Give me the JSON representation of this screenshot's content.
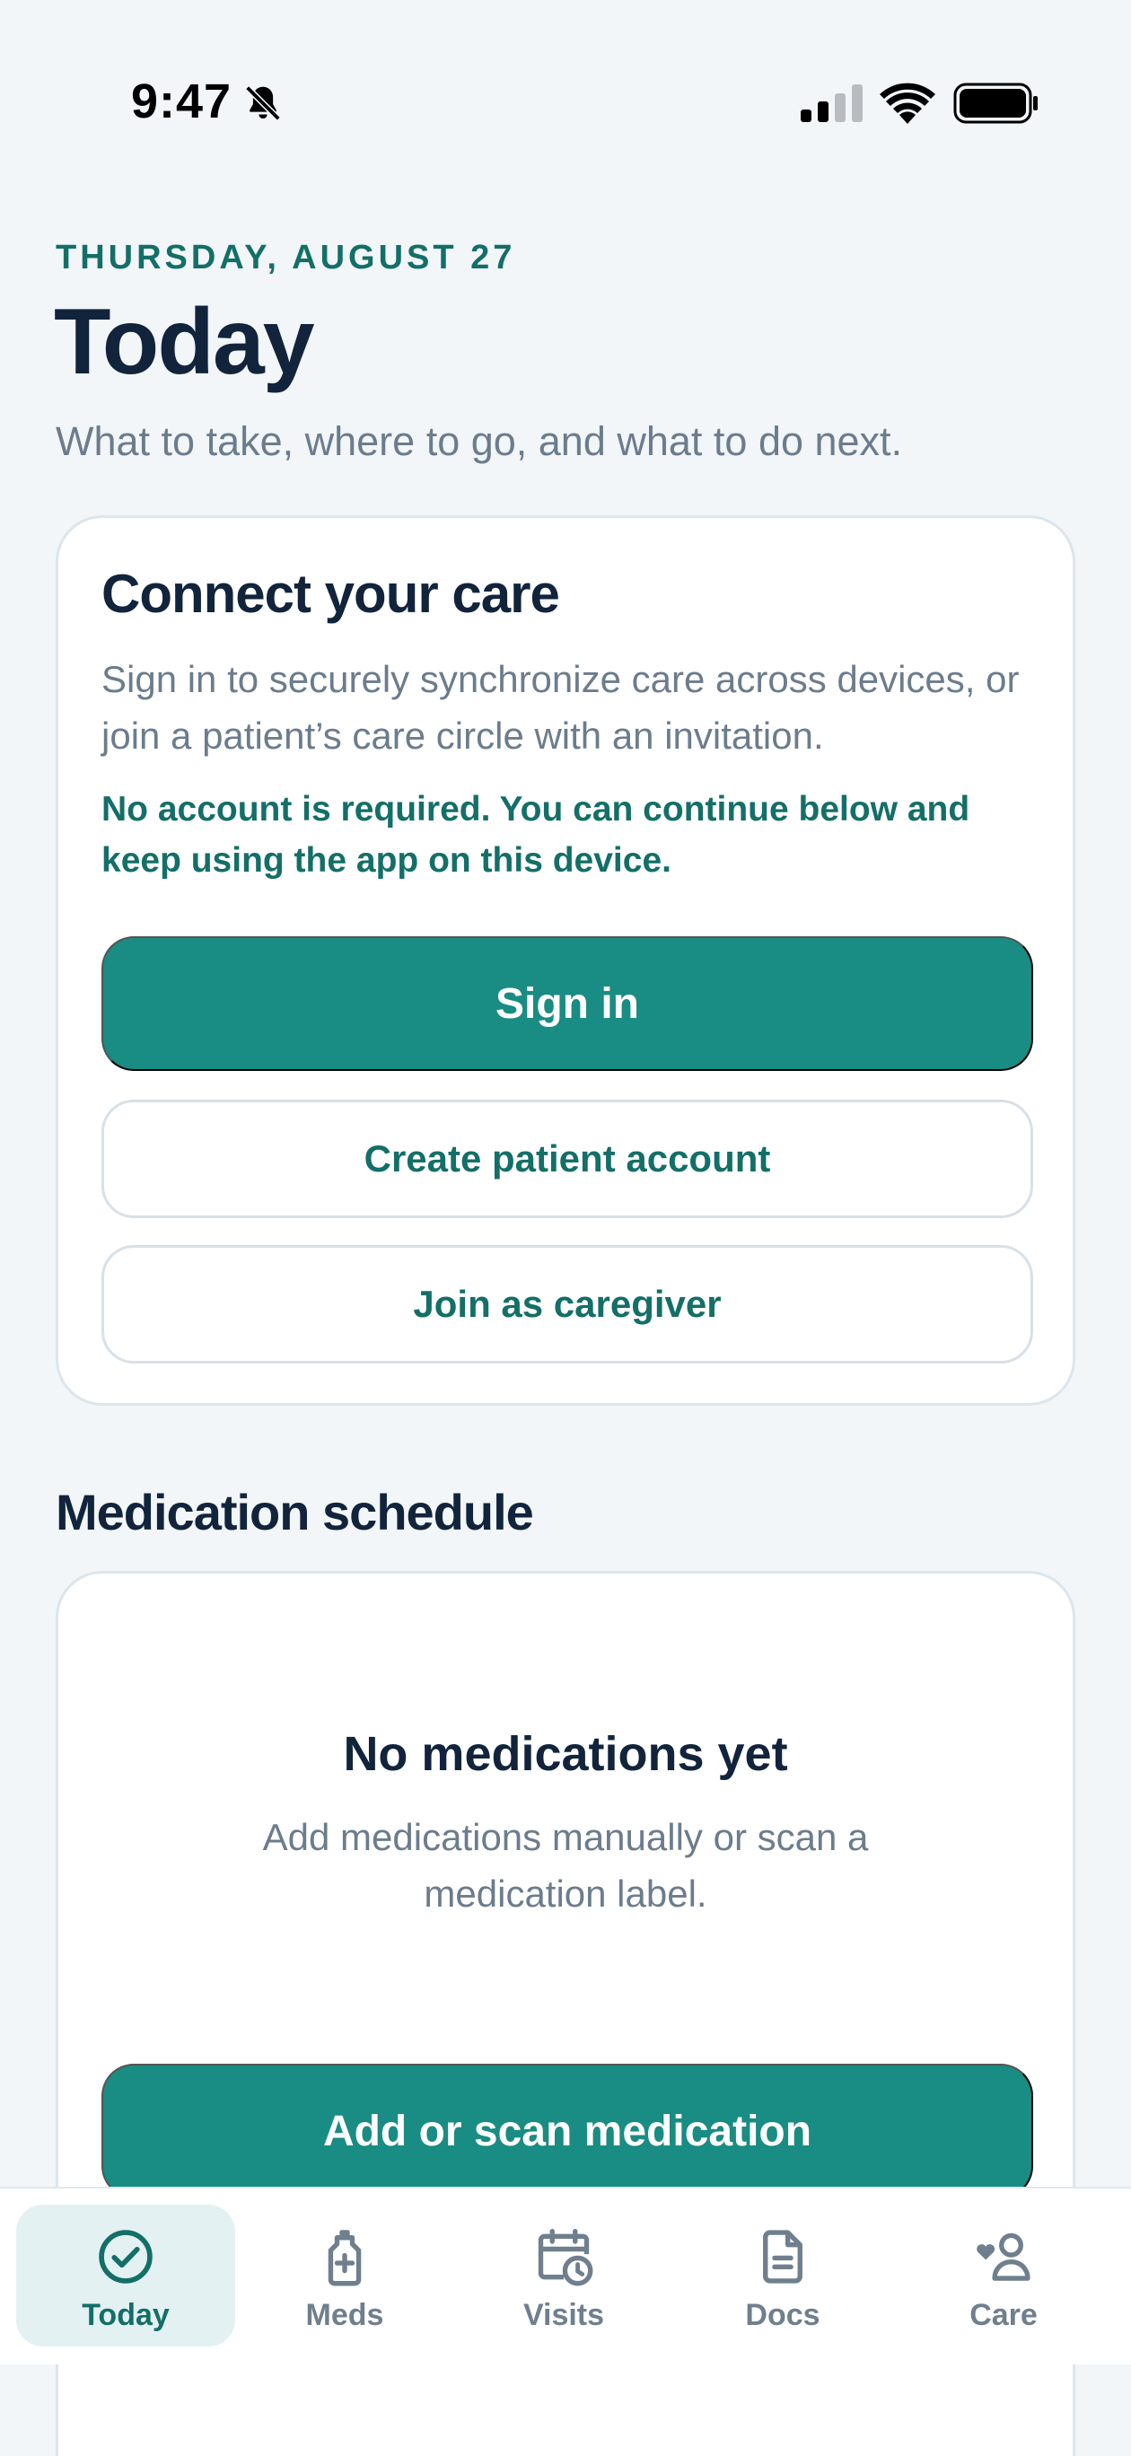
{
  "status_bar": {
    "time": "9:47"
  },
  "header": {
    "date": "THURSDAY, AUGUST 27",
    "title": "Today",
    "subtitle": "What to take, where to go, and what to do next."
  },
  "connect_card": {
    "title": "Connect your care",
    "description": "Sign in to securely synchronize care across devices, or join a patient’s care circle with an invitation.",
    "note": "No account is required. You can continue below and keep using the app on this device.",
    "sign_in_label": "Sign in",
    "create_account_label": "Create patient account",
    "join_caregiver_label": "Join as caregiver"
  },
  "medication_section": {
    "heading": "Medication schedule",
    "empty_title": "No medications yet",
    "empty_description": "Add medications manually or scan a medication label.",
    "add_button_label": "Add or scan medication"
  },
  "bottom_nav": {
    "items": [
      {
        "label": "Today",
        "icon": "check-circle-icon",
        "active": true
      },
      {
        "label": "Meds",
        "icon": "medicine-bottle-icon",
        "active": false
      },
      {
        "label": "Visits",
        "icon": "calendar-clock-icon",
        "active": false
      },
      {
        "label": "Docs",
        "icon": "document-icon",
        "active": false
      },
      {
        "label": "Care",
        "icon": "caregiver-icon",
        "active": false
      }
    ]
  },
  "colors": {
    "accent": "#198c83",
    "accent_text": "#136f67",
    "heading": "#11243c",
    "muted": "#6b7c8d",
    "background": "#f2f6f9"
  }
}
